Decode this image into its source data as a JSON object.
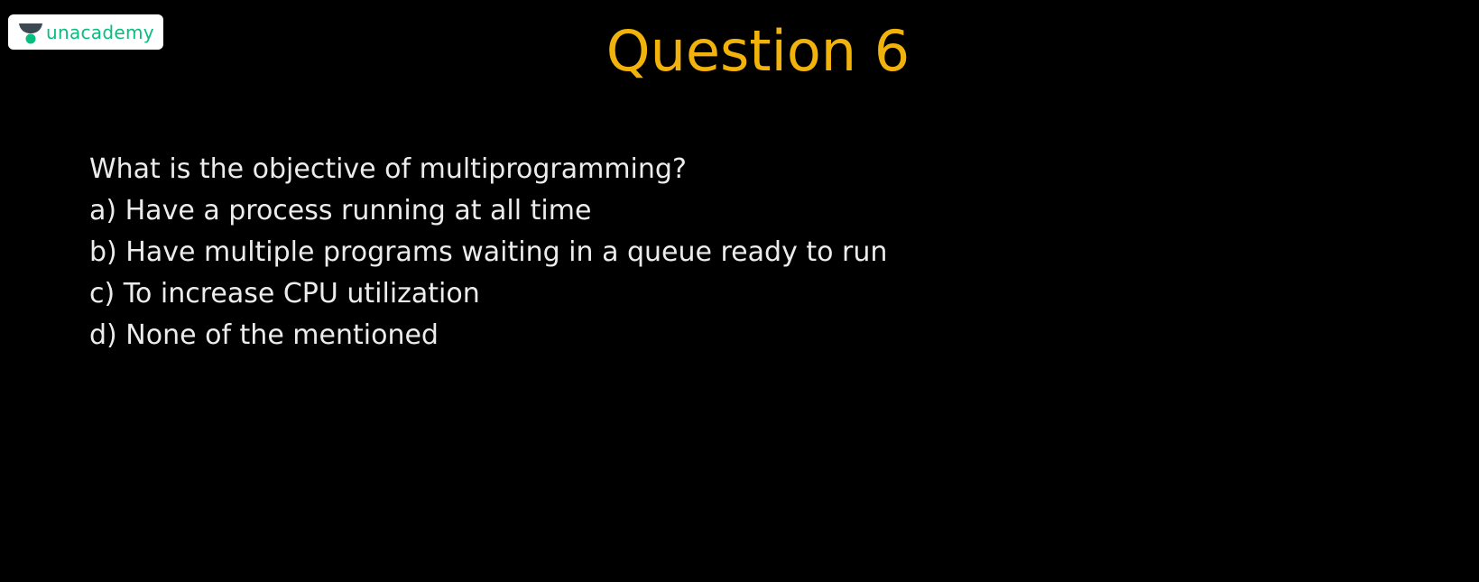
{
  "branding": {
    "logo_text": "unacademy",
    "logo_icon": "unacademy-logo-icon",
    "logo_text_color": "#08bd80",
    "logo_mark_top_color": "#3c4852",
    "logo_mark_bottom_color": "#08bd80"
  },
  "slide": {
    "title": "Question 6",
    "title_color": "#f2b20c",
    "background_color": "#000000",
    "text_color": "#ececec",
    "question": "What is the objective of multiprogramming?",
    "options": [
      "a) Have a process running at all time",
      "b) Have multiple programs waiting in a queue ready to run",
      "c) To increase CPU utilization",
      "d) None of the mentioned"
    ]
  }
}
